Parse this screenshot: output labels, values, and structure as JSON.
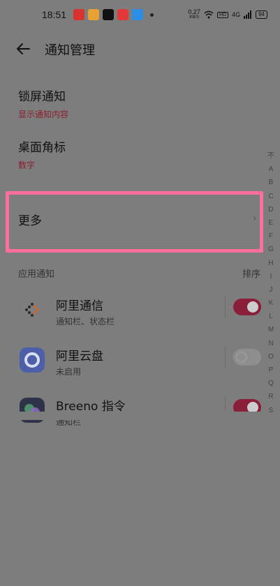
{
  "status": {
    "time": "18:51",
    "net_speed": "0.27",
    "net_unit": "KB/S",
    "hd": "HD",
    "signal": "4G",
    "battery": "94",
    "app_icons": [
      {
        "name": "news-app-icon",
        "color": "#d9332f"
      },
      {
        "name": "weibo-icon",
        "color": "#e8a233"
      },
      {
        "name": "tiktok-icon",
        "color": "#111111"
      },
      {
        "name": "app-red-icon",
        "color": "#e23a3a"
      },
      {
        "name": "app-blue-icon",
        "color": "#2a8ee6"
      }
    ]
  },
  "header": {
    "title": "通知管理"
  },
  "settings": [
    {
      "title": "锁屏通知",
      "value": "显示通知内容"
    },
    {
      "title": "桌面角标",
      "value": "数字"
    }
  ],
  "more": {
    "label": "更多",
    "chevron": "›"
  },
  "app_section": {
    "title": "应用通知",
    "sort_label": "排序"
  },
  "apps": [
    {
      "name": "阿里通信",
      "sub": "通知栏、状态栏",
      "enabled": true
    },
    {
      "name": "阿里云盘",
      "sub": "未启用",
      "enabled": false
    },
    {
      "name": "Breeno 指令",
      "sub": "通知栏",
      "enabled": true
    }
  ],
  "index_letters": [
    "不",
    "A",
    "B",
    "C",
    "D",
    "E",
    "F",
    "G",
    "H",
    "I",
    "J",
    "K",
    "L",
    "M",
    "N",
    "O",
    "P",
    "Q",
    "R",
    "S"
  ],
  "colors": {
    "accent": "#8a1f3a",
    "highlight": "#ff6f9b",
    "background": "#7d7d7d"
  }
}
